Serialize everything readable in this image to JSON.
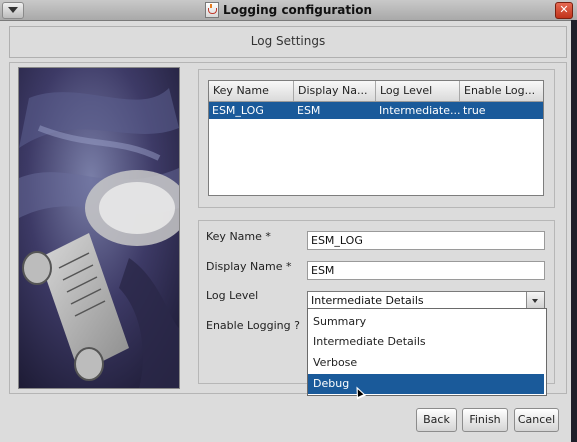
{
  "window": {
    "title": "Logging configuration",
    "close_glyph": "✕"
  },
  "header": {
    "title": "Log Settings"
  },
  "table": {
    "columns": [
      "Key Name",
      "Display Na...",
      "Log Level",
      "Enable Log..."
    ],
    "rows": [
      {
        "key_name": "ESM_LOG",
        "display_name": "ESM",
        "log_level": "Intermediate...",
        "enable_logging": "true",
        "selected": true
      }
    ]
  },
  "form": {
    "key_name_label": "Key Name *",
    "key_name_value": "ESM_LOG",
    "display_name_label": "Display Name *",
    "display_name_value": "ESM",
    "log_level_label": "Log Level",
    "log_level_value": "Intermediate Details",
    "enable_logging_label": "Enable Logging ?"
  },
  "dropdown": {
    "options": [
      "Summary",
      "Intermediate Details",
      "Verbose",
      "Debug"
    ],
    "highlighted": "Debug"
  },
  "buttons": {
    "back": "Back",
    "finish": "Finish",
    "cancel": "Cancel"
  },
  "colors": {
    "selection": "#1a5a9a",
    "window_bg": "#dcdcdc"
  }
}
